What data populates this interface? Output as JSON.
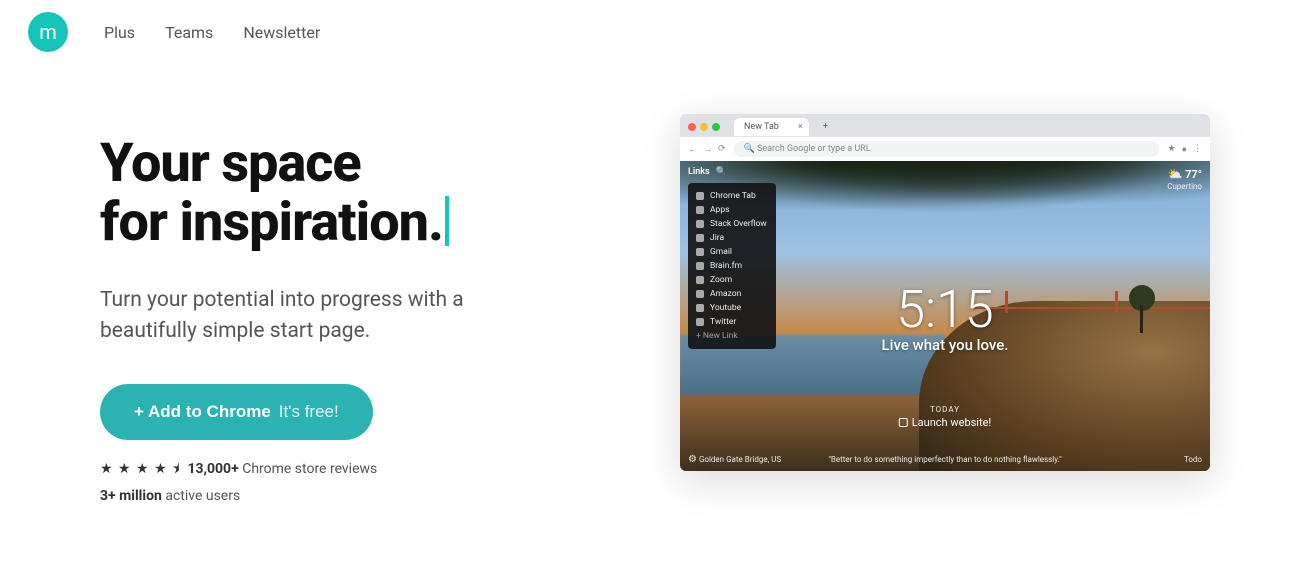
{
  "logo_letter": "m",
  "nav": [
    "Plus",
    "Teams",
    "Newsletter"
  ],
  "hero": {
    "title_line1": "Your space",
    "title_line2": "for inspiration.",
    "subtitle": "Turn your potential into progress with a beautifully simple start page.",
    "cta_label": "+ Add to Chrome",
    "cta_free": "It's free!",
    "reviews_count": "13,000+",
    "reviews_tail": "Chrome store reviews",
    "users_count": "3+ million",
    "users_tail": "active users"
  },
  "browser": {
    "tab_label": "New Tab",
    "url_placeholder": "Search Google or type a URL"
  },
  "preview": {
    "links_label": "Links",
    "weather_temp": "77°",
    "weather_loc": "Cupertino",
    "dropdown": [
      "Chrome Tab",
      "Apps",
      "Stack Overflow",
      "Jira",
      "Gmail",
      "Brain.fm",
      "Zoom",
      "Amazon",
      "Youtube",
      "Twitter"
    ],
    "new_link": "+  New Link",
    "time": "5:15",
    "mantra": "Live what you love.",
    "today": "TODAY",
    "launch": "Launch website!",
    "photo_credit": "Golden Gate Bridge, US",
    "quote": "\"Better to do something imperfectly than to do nothing flawlessly.\"",
    "todo": "Todo"
  }
}
